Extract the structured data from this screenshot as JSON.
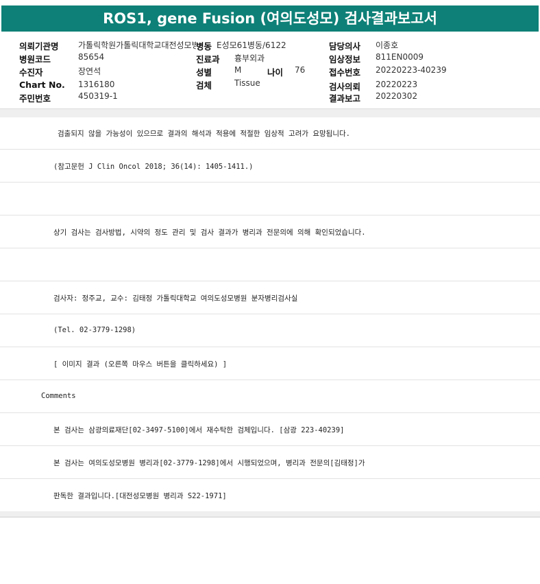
{
  "title": "ROS1, gene Fusion (여의도성모) 검사결과보고서",
  "info": {
    "institution_label": "의뢰기관명",
    "institution_value": "가톨릭학원가톨릭대학교대전성모병원(병동",
    "ward_label": "병동",
    "ward_value": "E성모61병동/6122",
    "doctor_label": "담당의사",
    "doctor_value": "이종호",
    "hospital_code_label": "병원코드",
    "hospital_code_value": "85654",
    "department_label": "진료과",
    "department_value": "흉부외과",
    "clinical_info_label": "임상정보",
    "clinical_info_value": "811EN0009",
    "examinee_label": "수진자",
    "examinee_value": "장연석",
    "sex_label": "성별",
    "sex_value": "M",
    "age_label": "나이",
    "age_value": "76",
    "receipt_no_label": "접수번호",
    "receipt_no_value": "20220223-40239",
    "chart_no_label": "Chart No.",
    "chart_no_value": "1316180",
    "specimen_label": "검체",
    "specimen_value": "Tissue",
    "request_label": "검사의뢰",
    "request_value": "20220223",
    "resident_no_label": "주민번호",
    "resident_no_value": "450319-1",
    "report_label": "결과보고",
    "report_value": "20220302"
  },
  "rows": [
    {
      "text": "검출되지 않을 가능성이 있으므로 결과의 해석과 적용에 적절한 임상적 고려가 요망됩니다."
    },
    {
      "text": "(참고문헌 J Clin Oncol 2018; 36(14): 1405-1411.)"
    },
    {
      "text": ""
    },
    {
      "text": "상기 검사는 검사방법, 시약의 정도 관리 및 검사 결과가 병리과 전문의에 의해 확인되었습니다."
    },
    {
      "text": ""
    },
    {
      "text": "검사자: 정주교, 교수: 김태정 가톨릭대학교 여의도성모병원 분자병리검사실"
    },
    {
      "text": "(Tel. 02-3779-1298)"
    },
    {
      "text": "[ 이미지 결과 (오른쪽 마우스 버튼을 클릭하세요) ]"
    },
    {
      "text": "Comments"
    },
    {
      "text": "본 검사는 삼광의료재단[02-3497-5100]에서 재수탁한 검체입니다. [삼광 223-40239]"
    },
    {
      "text": "본 검사는 여의도성모병원 병리과[02-3779-1298]에서 시행되었으며, 병리과 전문의[김태정]가"
    },
    {
      "text": "판독한 결과입니다.[대전성모병원 병리과 S22-1971]"
    }
  ]
}
